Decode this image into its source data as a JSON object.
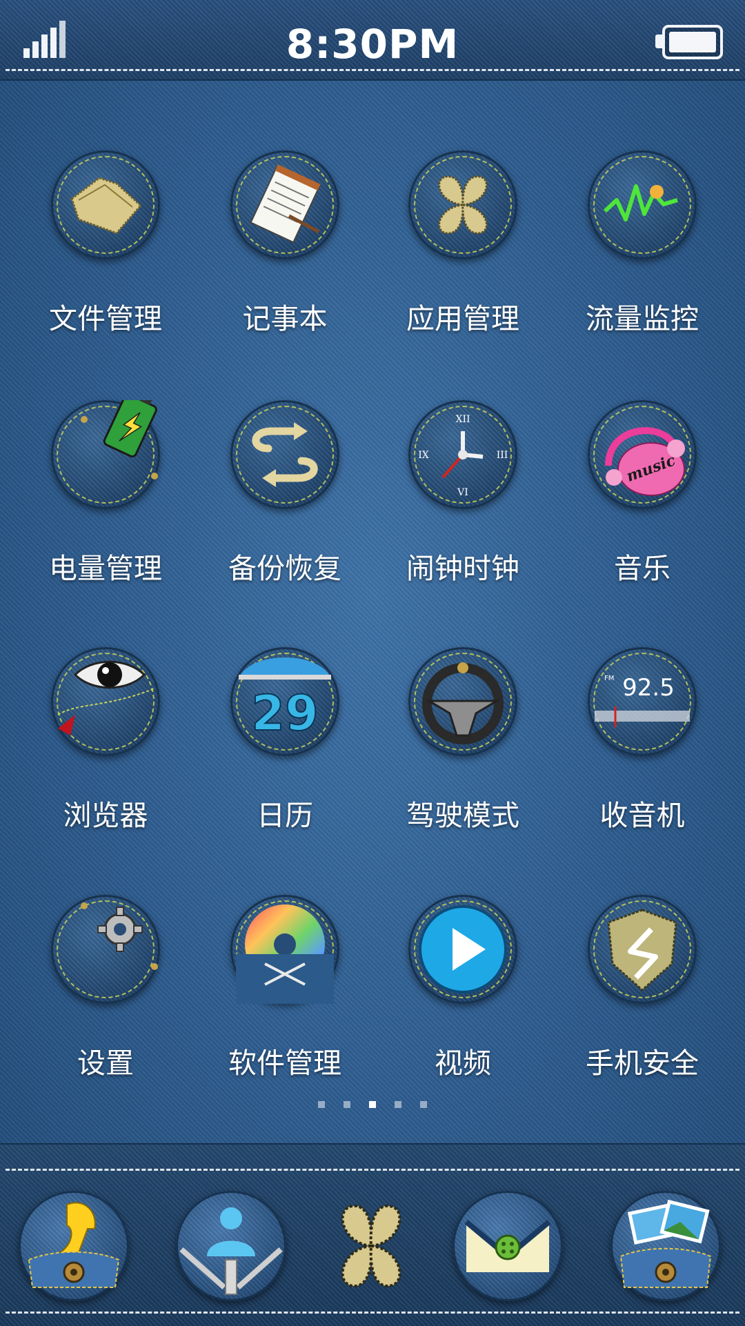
{
  "status_bar": {
    "time": "8:30PM",
    "signal_icon": "signal-bars-icon",
    "battery_icon": "battery-icon",
    "battery_level": 1.0
  },
  "apps": [
    {
      "label": "文件管理",
      "icon": "folder-icon"
    },
    {
      "label": "记事本",
      "icon": "notepad-icon"
    },
    {
      "label": "应用管理",
      "icon": "four-leaf-clover-icon"
    },
    {
      "label": "流量监控",
      "icon": "traffic-graph-icon"
    },
    {
      "label": "电量管理",
      "icon": "battery-charge-icon"
    },
    {
      "label": "备份恢复",
      "icon": "backup-arrows-icon"
    },
    {
      "label": "闹钟时钟",
      "icon": "clock-icon"
    },
    {
      "label": "音乐",
      "icon": "headphones-icon",
      "badge_text": "music"
    },
    {
      "label": "浏览器",
      "icon": "eye-icon"
    },
    {
      "label": "日历",
      "icon": "calendar-icon",
      "day": "29"
    },
    {
      "label": "驾驶模式",
      "icon": "steering-wheel-icon"
    },
    {
      "label": "收音机",
      "icon": "radio-icon",
      "frequency": "92.5",
      "band": "FM"
    },
    {
      "label": "设置",
      "icon": "gear-icon"
    },
    {
      "label": "软件管理",
      "icon": "disc-icon"
    },
    {
      "label": "视频",
      "icon": "play-icon"
    },
    {
      "label": "手机安全",
      "icon": "shield-icon"
    }
  ],
  "pager": {
    "count": 5,
    "active_index": 2
  },
  "dock": [
    {
      "icon": "phone-icon"
    },
    {
      "icon": "contacts-icon"
    },
    {
      "icon": "app-drawer-clover-icon"
    },
    {
      "icon": "messages-icon"
    },
    {
      "icon": "gallery-icon"
    }
  ],
  "colors": {
    "denim": "#2f5f92",
    "stitch_yellow": "#c9d45a",
    "stitch_white": "#dfe6ee",
    "text": "#ffffff",
    "play_blue": "#1fa8e6",
    "music_pink": "#ec3d9a",
    "graph_green": "#4ee63a"
  }
}
